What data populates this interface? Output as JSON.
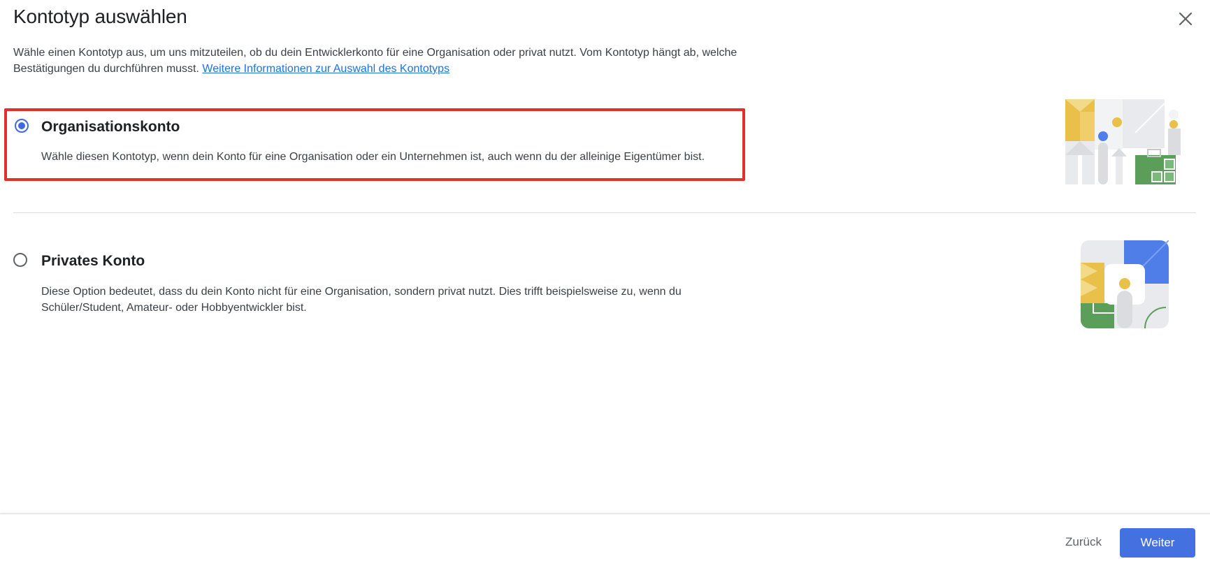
{
  "dialog": {
    "title": "Kontotyp auswählen",
    "close_icon": "close-icon"
  },
  "intro": {
    "text": "Wähle einen Kontotyp aus, um uns mitzuteilen, ob du dein Entwicklerkonto für eine Organisation oder privat nutzt. Vom Kontotyp hängt ab, welche Bestätigungen du durchführen musst. ",
    "link_text": "Weitere Informationen zur Auswahl des Kontotyps"
  },
  "options": [
    {
      "title": "Organisationskonto",
      "description": "Wähle diesen Kontotyp, wenn dein Konto für eine Organisation oder ein Unternehmen ist, auch wenn du der alleinige Eigentümer bist.",
      "selected": true,
      "illustration": "organisation-illustration"
    },
    {
      "title": "Privates Konto",
      "description": "Diese Option bedeutet, dass du dein Konto nicht für eine Organisation, sondern privat nutzt. Dies trifft beispielsweise zu, wenn du Schüler/Student, Amateur- oder Hobbyentwickler bist.",
      "selected": false,
      "illustration": "personal-illustration"
    }
  ],
  "footer": {
    "back_label": "Zurück",
    "next_label": "Weiter"
  },
  "colors": {
    "accent": "#4372e0",
    "highlight": "#e0322a",
    "illus_yellow": "#e8c04a",
    "illus_blue": "#4f7ee8",
    "illus_green": "#5a9e5a",
    "illus_gray": "#e8eaed"
  }
}
